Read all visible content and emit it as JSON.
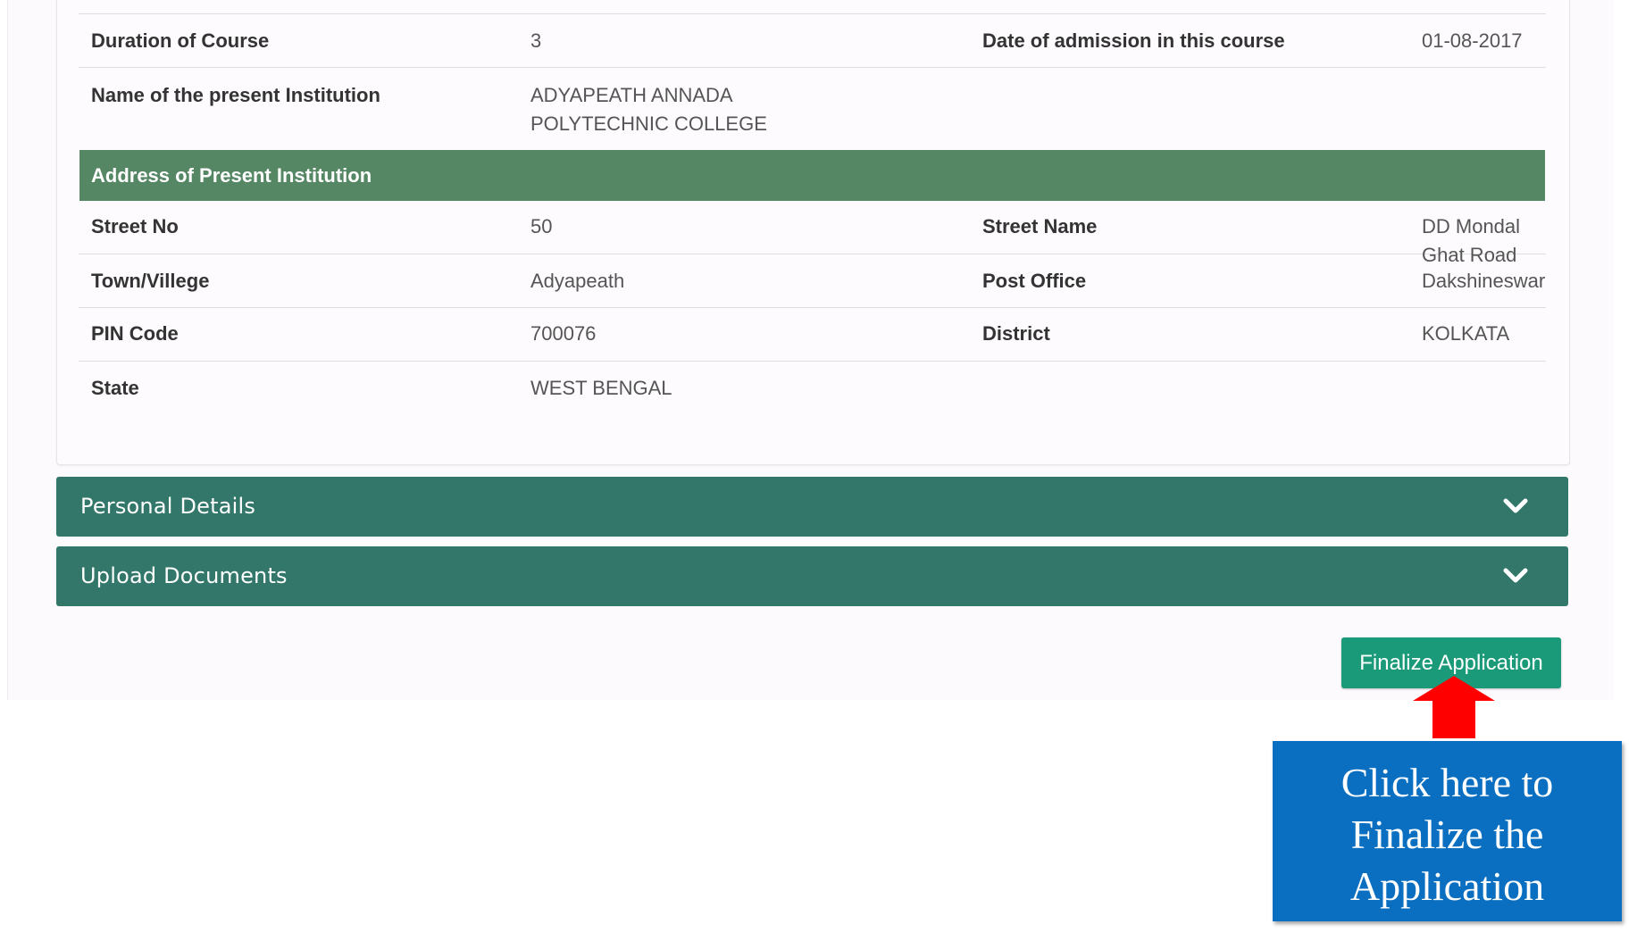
{
  "course_rows": [
    {
      "label1": "Duration of Course",
      "value1": "3",
      "label2": "Date of admission in this course",
      "value2": "01-08-2017"
    },
    {
      "label1": "Name of the present Institution",
      "value1_line1": "ADYAPEATH ANNADA",
      "value1_line2": "POLYTECHNIC COLLEGE"
    }
  ],
  "address_section": {
    "title": "Address of Present Institution",
    "rows": [
      {
        "label1": "Street No",
        "value1": "50",
        "label2": "Street Name",
        "value2": "DD Mondal Ghat Road"
      },
      {
        "label1": "Town/Villege",
        "value1": "Adyapeath",
        "label2": "Post Office",
        "value2": "Dakshineswar"
      },
      {
        "label1": "PIN Code",
        "value1": "700076",
        "label2": "District",
        "value2": "KOLKATA"
      },
      {
        "label1": "State",
        "value1": "WEST BENGAL"
      }
    ]
  },
  "accordions": [
    {
      "label": "Personal Details",
      "icon": "chevron-down-icon"
    },
    {
      "label": "Upload Documents",
      "icon": "chevron-down-icon"
    }
  ],
  "finalize_button": {
    "label": "Finalize Application"
  },
  "callout": {
    "line1": "Click here to",
    "line2": "Finalize the",
    "line3": "Application",
    "arrow_color": "#ff0000",
    "box_color": "#0b6fc1"
  },
  "colors": {
    "section_header": "#558764",
    "accordion": "#32776a",
    "finalize_button": "#1a9a78"
  }
}
